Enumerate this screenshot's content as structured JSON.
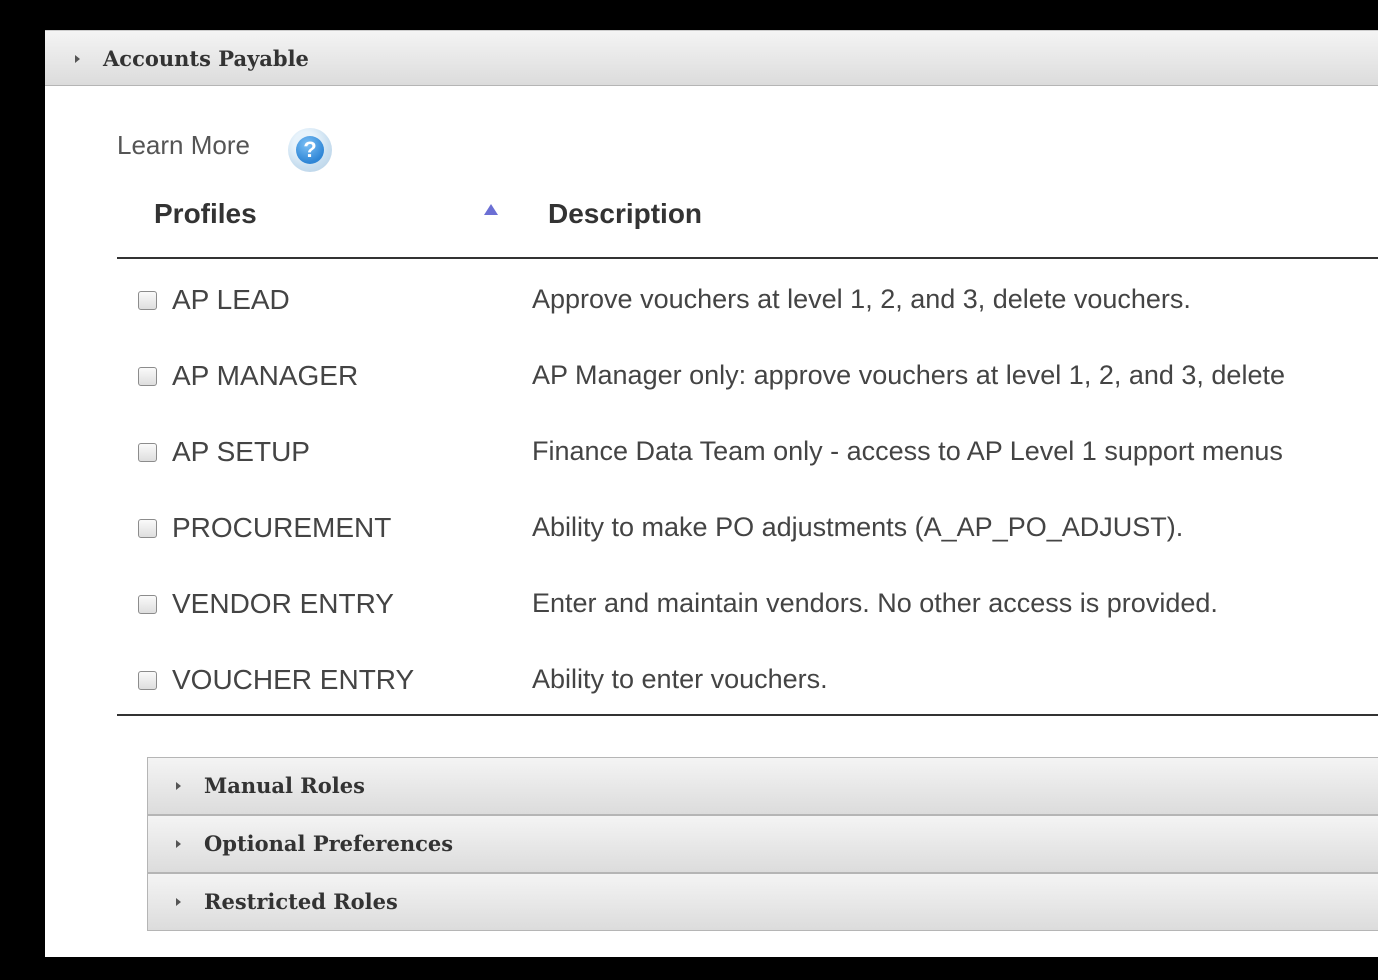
{
  "section": {
    "title": "Accounts Payable"
  },
  "learn_more": {
    "label": "Learn More",
    "icon_glyph": "?"
  },
  "table": {
    "columns": [
      "Profiles",
      "Description"
    ],
    "rows": [
      {
        "profile": "AP LEAD",
        "description": "Approve vouchers at level 1, 2, and 3, delete vouchers."
      },
      {
        "profile": "AP MANAGER",
        "description": "AP Manager only: approve vouchers at level 1, 2, and 3, delete"
      },
      {
        "profile": "AP SETUP",
        "description": "Finance Data Team only - access to AP Level 1 support menus"
      },
      {
        "profile": "PROCUREMENT",
        "description": "Ability to make PO adjustments (A_AP_PO_ADJUST)."
      },
      {
        "profile": "VENDOR ENTRY",
        "description": "Enter and maintain vendors. No other access is provided."
      },
      {
        "profile": "VOUCHER ENTRY",
        "description": "Ability to enter vouchers."
      }
    ]
  },
  "subsections": [
    {
      "title": "Manual Roles"
    },
    {
      "title": "Optional Preferences"
    },
    {
      "title": "Restricted Roles"
    }
  ],
  "colors": {
    "accent_sort": "#6b6fd4",
    "help_icon": "#2f86d6"
  }
}
